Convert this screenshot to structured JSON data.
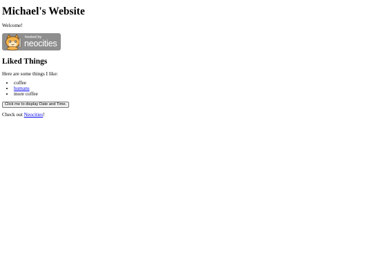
{
  "page": {
    "title": "Michael's Website",
    "welcome": "Welcome!"
  },
  "badge": {
    "hosted_text": "hosted by",
    "brand_text": "neocities",
    "mascot_icon": "neocities-cat-icon",
    "background": "#8e8e8e"
  },
  "liked": {
    "heading": "Liked Things",
    "intro": "Here are some things I like:",
    "items": [
      {
        "text": "coffee",
        "is_link": false
      },
      {
        "text": "humans",
        "is_link": true
      },
      {
        "text": "more coffee",
        "is_link": false
      }
    ]
  },
  "datetime_button": {
    "label": "Click me to display Date and Time."
  },
  "footer": {
    "prefix": "Check out ",
    "link_text": "Neocities",
    "suffix": "!"
  },
  "colors": {
    "link": "#0000ee",
    "text": "#000000",
    "background": "#ffffff"
  }
}
